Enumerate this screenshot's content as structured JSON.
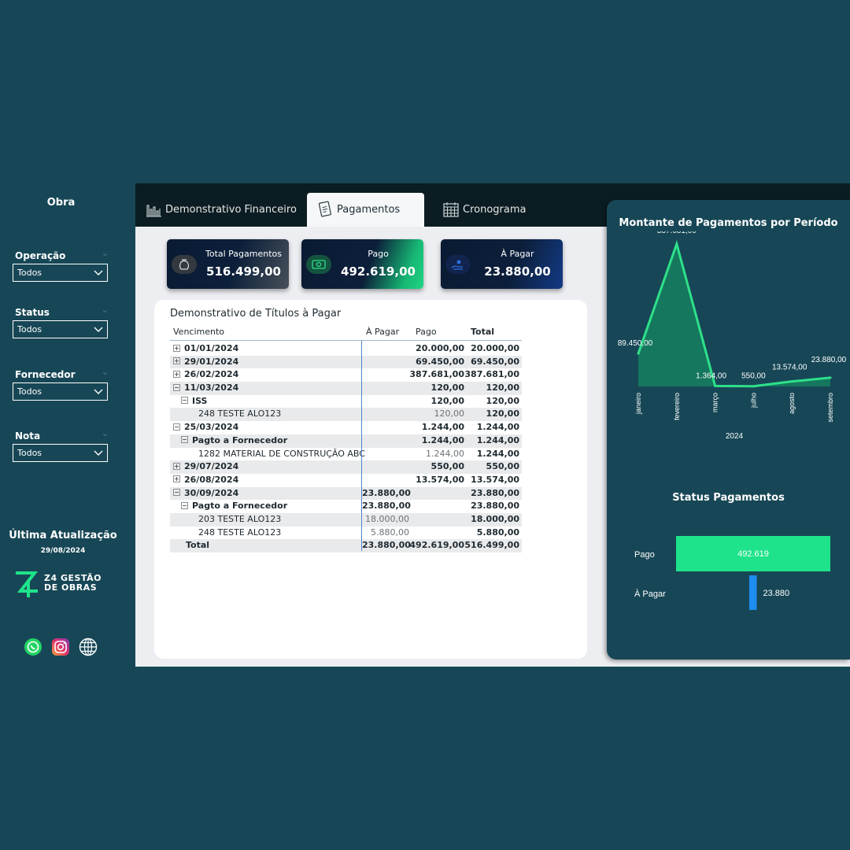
{
  "sidebar": {
    "title": "Obra",
    "filters": [
      {
        "label": "Operação",
        "value": "Todos"
      },
      {
        "label": "Status",
        "value": "Todos"
      },
      {
        "label": "Fornecedor",
        "value": "Todos"
      },
      {
        "label": "Nota",
        "value": "Todos"
      }
    ],
    "update_label": "Última Atualização",
    "update_date": "29/08/2024",
    "logo_line1": "Z4 GESTÃO",
    "logo_line2": "DE OBRAS"
  },
  "tabs": [
    {
      "label": "Demonstrativo Financeiro",
      "icon": "bar-chart-icon"
    },
    {
      "label": "Pagamentos",
      "icon": "payment-document-icon"
    },
    {
      "label": "Cronograma",
      "icon": "calendar-icon"
    }
  ],
  "kpis": [
    {
      "label": "Total Pagamentos",
      "value": "516.499,00",
      "icon": "money-bag-icon"
    },
    {
      "label": "Pago",
      "value": "492.619,00",
      "icon": "banknote-icon"
    },
    {
      "label": "À Pagar",
      "value": "23.880,00",
      "icon": "coins-hand-icon"
    }
  ],
  "table": {
    "title": "Demonstrativo de Títulos à Pagar",
    "headers": {
      "label": "Vencimento",
      "apagar": "À Pagar",
      "pago": "Pago",
      "total": "Total"
    },
    "rows": [
      {
        "level": 0,
        "expander": "+",
        "label": "01/01/2024",
        "apagar": "",
        "pago": "20.000,00",
        "total": "20.000,00"
      },
      {
        "level": 0,
        "expander": "+",
        "label": "29/01/2024",
        "apagar": "",
        "pago": "69.450,00",
        "total": "69.450,00"
      },
      {
        "level": 0,
        "expander": "+",
        "label": "26/02/2024",
        "apagar": "",
        "pago": "387.681,00",
        "total": "387.681,00"
      },
      {
        "level": 0,
        "expander": "−",
        "label": "11/03/2024",
        "apagar": "",
        "pago": "120,00",
        "total": "120,00"
      },
      {
        "level": 1,
        "expander": "−",
        "label": "ISS",
        "apagar": "",
        "pago": "120,00",
        "total": "120,00"
      },
      {
        "level": 2,
        "expander": "",
        "label": "248 TESTE ALO123",
        "apagar": "",
        "pago": "120,00",
        "total": "120,00"
      },
      {
        "level": 0,
        "expander": "−",
        "label": "25/03/2024",
        "apagar": "",
        "pago": "1.244,00",
        "total": "1.244,00"
      },
      {
        "level": 1,
        "expander": "−",
        "label": "Pagto a Fornecedor",
        "apagar": "",
        "pago": "1.244,00",
        "total": "1.244,00"
      },
      {
        "level": 2,
        "expander": "",
        "label": "1282 MATERIAL DE CONSTRUÇÃO ABC",
        "apagar": "",
        "pago": "1.244,00",
        "total": "1.244,00"
      },
      {
        "level": 0,
        "expander": "+",
        "label": "29/07/2024",
        "apagar": "",
        "pago": "550,00",
        "total": "550,00"
      },
      {
        "level": 0,
        "expander": "+",
        "label": "26/08/2024",
        "apagar": "",
        "pago": "13.574,00",
        "total": "13.574,00"
      },
      {
        "level": 0,
        "expander": "−",
        "label": "30/09/2024",
        "apagar": "23.880,00",
        "pago": "",
        "total": "23.880,00"
      },
      {
        "level": 1,
        "expander": "−",
        "label": "Pagto a Fornecedor",
        "apagar": "23.880,00",
        "pago": "",
        "total": "23.880,00"
      },
      {
        "level": 2,
        "expander": "",
        "label": "203 TESTE ALO123",
        "apagar": "18.000,00",
        "pago": "",
        "total": "18.000,00"
      },
      {
        "level": 2,
        "expander": "",
        "label": "248 TESTE ALO123",
        "apagar": "5.880,00",
        "pago": "",
        "total": "5.880,00"
      },
      {
        "level": 3,
        "expander": "",
        "label": "Total",
        "apagar": "23.880,00",
        "pago": "492.619,00",
        "total": "516.499,00"
      }
    ]
  },
  "chart_data": [
    {
      "type": "area",
      "title": "Montante de Pagamentos por Período",
      "categories": [
        "janeiro",
        "fevereiro",
        "março",
        "julho",
        "agosto",
        "setembro"
      ],
      "values": [
        89450,
        387681,
        1364,
        550,
        13574,
        23880
      ],
      "data_labels": [
        "89.450,00",
        "387.681,00",
        "1.364,00",
        "550,00",
        "13.574,00",
        "23.880,00"
      ],
      "xlabel": "2024",
      "colors": {
        "line": "#2ee08a",
        "fill": "#15775d"
      }
    },
    {
      "type": "bar",
      "title": "Status Pagamentos",
      "categories": [
        "Pago",
        "À Pagar"
      ],
      "values": [
        492619,
        23880
      ],
      "data_labels": [
        "492.619",
        "23.880"
      ],
      "colors": [
        "#1ee38a",
        "#1e8cf0"
      ]
    }
  ],
  "colors": {
    "background": "#174756",
    "accent_green": "#1ee38a",
    "accent_blue": "#1e8cf0",
    "tabbar": "#0b1d22"
  }
}
